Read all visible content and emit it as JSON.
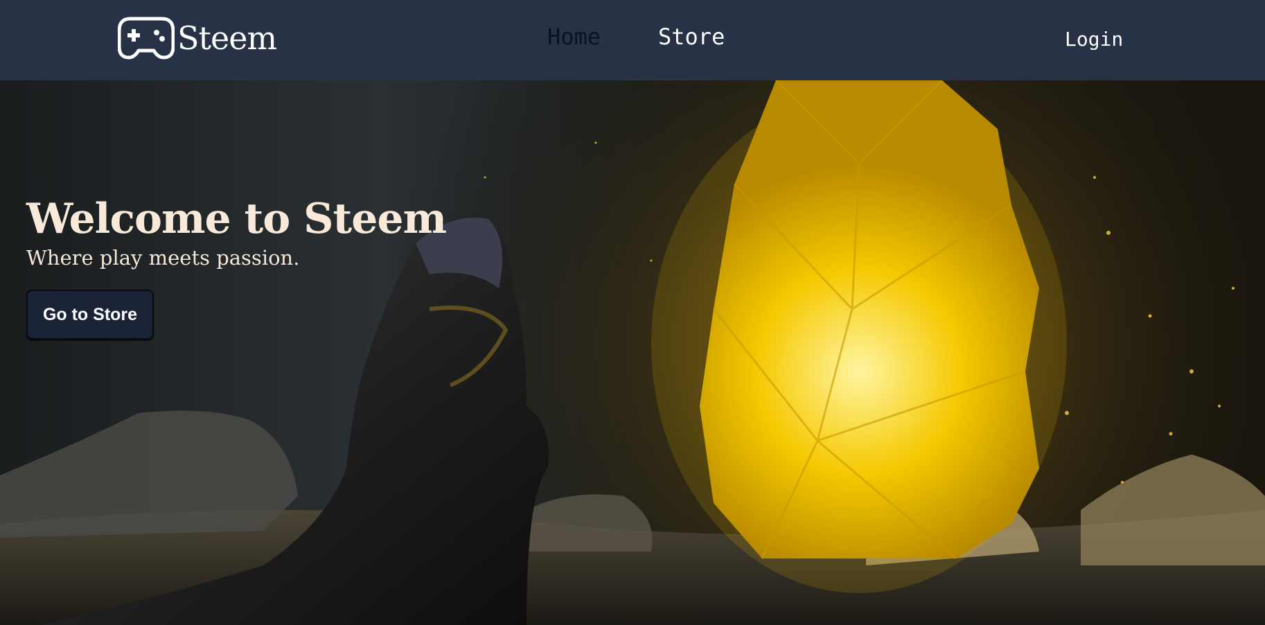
{
  "header": {
    "brand": "Steem",
    "brand_icon": "gamepad-icon",
    "nav": {
      "home": "Home",
      "store": "Store",
      "login": "Login"
    }
  },
  "hero": {
    "title": "Welcome to Steem",
    "subtitle": "Where play meets passion.",
    "cta_label": "Go to Store"
  },
  "colors": {
    "navbar_bg": "#273247",
    "active_link": "#0b1224",
    "button_bg": "#1a2236",
    "crystal": "#f5c400"
  }
}
